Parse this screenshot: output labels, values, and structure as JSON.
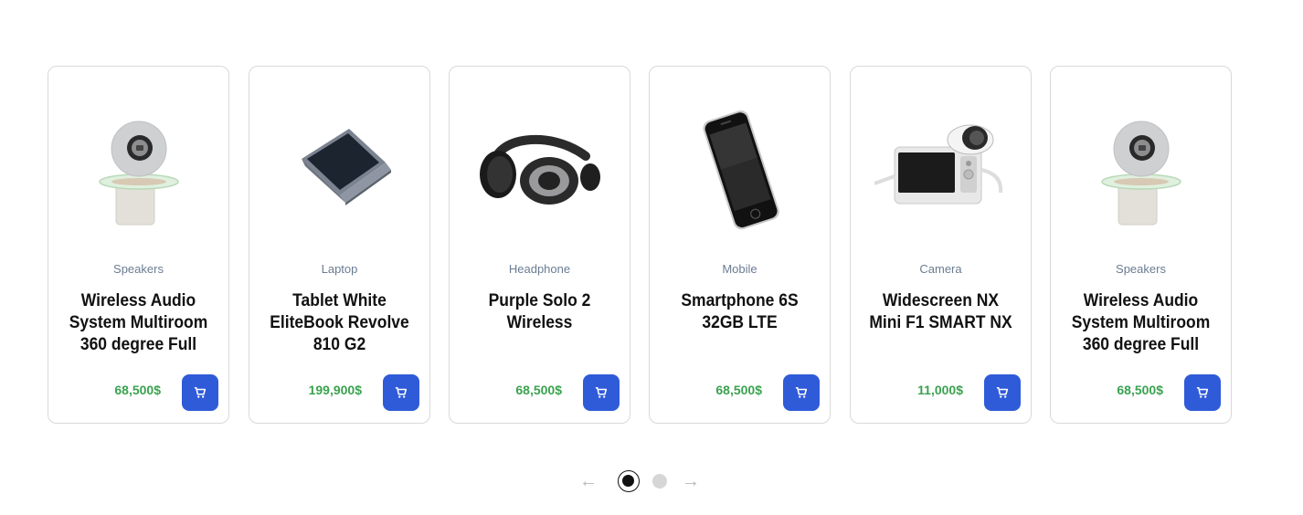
{
  "products": [
    {
      "category": "Speakers",
      "title": "Wireless Audio System Multiroom 360 degree Full",
      "price": "68,500$",
      "image": "speaker-image"
    },
    {
      "category": "Laptop",
      "title": "Tablet White EliteBook Revolve 810 G2",
      "price": "199,900$",
      "image": "laptop-image"
    },
    {
      "category": "Headphone",
      "title": "Purple Solo 2 Wireless",
      "price": "68,500$",
      "image": "headphone-image"
    },
    {
      "category": "Mobile",
      "title": "Smartphone 6S 32GB LTE",
      "price": "68,500$",
      "image": "smartphone-image"
    },
    {
      "category": "Camera",
      "title": "Widescreen NX Mini F1 SMART NX",
      "price": "11,000$",
      "image": "camera-image"
    },
    {
      "category": "Speakers",
      "title": "Wireless Audio System Multiroom 360 degree Full",
      "price": "68,500$",
      "image": "speaker-image"
    }
  ],
  "pagination": {
    "prev_icon": "arrow-left-icon",
    "next_icon": "arrow-right-icon",
    "pages": 2,
    "active_page": 1
  },
  "colors": {
    "price": "#3aa24f",
    "cart_button": "#2f5bd8",
    "category": "#6b7c93"
  }
}
